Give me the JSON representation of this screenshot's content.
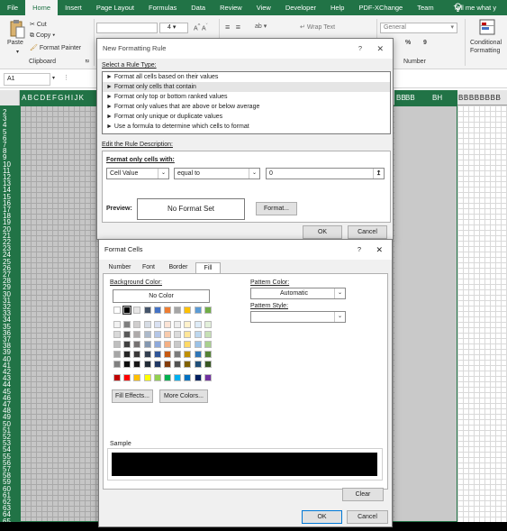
{
  "ribbon": {
    "tabs": [
      "File",
      "Home",
      "Insert",
      "Page Layout",
      "Formulas",
      "Data",
      "Review",
      "View",
      "Developer",
      "Help",
      "PDF-XChange",
      "Team"
    ],
    "tell_me": "Tell me what y",
    "clipboard": {
      "paste": "Paste",
      "cut": "Cut",
      "copy": "Copy",
      "format_painter": "Format Painter",
      "group": "Clipboard"
    },
    "font_size": "4",
    "wrap_text": "Wrap Text",
    "number_format": "General",
    "number_group": "Number",
    "percent": "%",
    "comma": "9",
    "conditional": "Conditional",
    "formatting": "Formatting",
    "accent_color": "#217346"
  },
  "namebox": "A1",
  "grid": {
    "green_cols": "ABCDEFGHIJK",
    "right_cols": [
      "BB",
      "BB"
    ],
    "selected_col": "BH",
    "rest_cols": "BBBBBBBB",
    "rows": [
      "2",
      "3",
      "4",
      "5",
      "6",
      "7",
      "8",
      "9",
      "10",
      "11",
      "12",
      "13",
      "14",
      "15",
      "16",
      "17",
      "18",
      "19",
      "20",
      "21",
      "22",
      "23",
      "24",
      "25",
      "26",
      "27",
      "28",
      "29",
      "30",
      "31",
      "32",
      "33",
      "34",
      "35",
      "36",
      "37",
      "38",
      "39",
      "40",
      "41",
      "42",
      "43",
      "44",
      "45",
      "46",
      "47",
      "48",
      "49",
      "50",
      "51",
      "52",
      "53",
      "54",
      "55",
      "56",
      "57",
      "58",
      "59",
      "60",
      "61",
      "62",
      "63",
      "64",
      "65"
    ]
  },
  "nfr": {
    "title": "New Formatting Rule",
    "help": "?",
    "close": "✕",
    "select_rule_type": "Select a Rule Type:",
    "rule_types": [
      "► Format all cells based on their values",
      "► Format only cells that contain",
      "► Format only top or bottom ranked values",
      "► Format only values that are above or below average",
      "► Format only unique or duplicate values",
      "► Use a formula to determine which cells to format"
    ],
    "edit_description": "Edit the Rule Description:",
    "format_only_with": "Format only cells with:",
    "condition_field": "Cell Value",
    "operator": "equal to",
    "value": "0",
    "preview_label": "Preview:",
    "preview_text": "No Format Set",
    "format_button": "Format...",
    "ok": "OK",
    "cancel": "Cancel"
  },
  "fc": {
    "title": "Format Cells",
    "help": "?",
    "close": "✕",
    "tabs": [
      "Number",
      "Font",
      "Border",
      "Fill"
    ],
    "active_tab": "Fill",
    "background_color": "Background Color:",
    "no_color": "No Color",
    "pattern_color": "Pattern Color:",
    "pattern_color_value": "Automatic",
    "pattern_style": "Pattern Style:",
    "pattern_style_value": "",
    "fill_effects": "Fill Effects...",
    "more_colors": "More Colors...",
    "sample": "Sample",
    "sample_color": "#000000",
    "clear": "Clear",
    "ok": "OK",
    "cancel": "Cancel",
    "palette_top": [
      "#ffffff",
      "#000000",
      "#e7e6e6",
      "#44546a",
      "#4472c4",
      "#ed7d31",
      "#a5a5a5",
      "#ffc000",
      "#5b9bd5",
      "#70ad47"
    ],
    "palette_tints": [
      [
        "#f2f2f2",
        "#7f7f7f",
        "#d0cece",
        "#d6dce4",
        "#d9e1f2",
        "#fce4d6",
        "#ededed",
        "#fff2cc",
        "#ddebf7",
        "#e2efda"
      ],
      [
        "#d9d9d9",
        "#595959",
        "#aeaaaa",
        "#acb9ca",
        "#b4c6e7",
        "#f8cbad",
        "#dbdbdb",
        "#ffe699",
        "#bdd7ee",
        "#c6e0b4"
      ],
      [
        "#bfbfbf",
        "#404040",
        "#757171",
        "#8497b0",
        "#8ea9db",
        "#f4b084",
        "#c9c9c9",
        "#ffd966",
        "#9bc2e6",
        "#a9d08e"
      ],
      [
        "#a6a6a6",
        "#262626",
        "#3a3838",
        "#333f4f",
        "#2f5597",
        "#c65911",
        "#7b7b7b",
        "#bf8f00",
        "#2e75b6",
        "#548235"
      ],
      [
        "#808080",
        "#0d0d0d",
        "#171616",
        "#222b35",
        "#203864",
        "#833c0b",
        "#525252",
        "#7f6000",
        "#1f4e78",
        "#375623"
      ]
    ],
    "palette_standard": [
      "#c00000",
      "#ff0000",
      "#ffc000",
      "#ffff00",
      "#92d050",
      "#00b050",
      "#00b0f0",
      "#0070c0",
      "#002060",
      "#7030a0"
    ]
  }
}
